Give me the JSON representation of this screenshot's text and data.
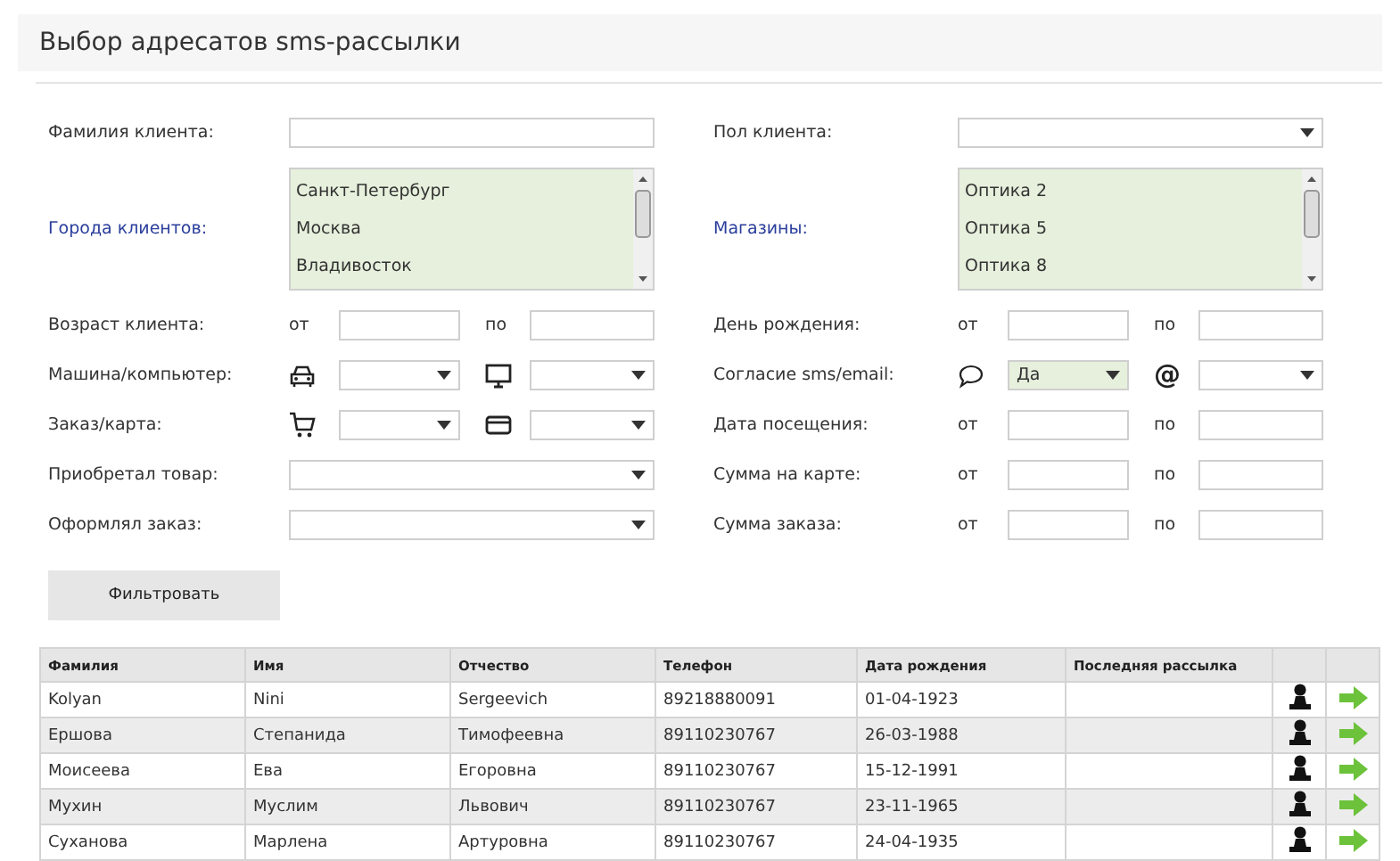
{
  "title": "Выбор адресатов sms-рассылки",
  "form": [
    {
      "left": {
        "label": "Фамилия клиента:",
        "kind": "text"
      },
      "right": {
        "label": "Пол клиента:",
        "kind": "select"
      }
    },
    {
      "left": {
        "label": "Города клиентов:",
        "kind": "listbox",
        "options": [
          "Санкт-Петербург",
          "Москва",
          "Владивосток"
        ]
      },
      "right": {
        "label": "Магазины:",
        "kind": "listbox",
        "options": [
          "Оптика 2",
          "Оптика 5",
          "Оптика 8"
        ]
      }
    },
    {
      "left": {
        "label": "Возраст клиента:",
        "kind": "range",
        "from": "от",
        "to": "по"
      },
      "right": {
        "label": "День рождения:",
        "kind": "range",
        "from": "от",
        "to": "по"
      }
    },
    {
      "left": {
        "label": "Машина/компьютер:",
        "kind": "pair",
        "selects": [
          {
            "kind": "car"
          },
          {
            "kind": "monitor"
          }
        ]
      },
      "right": {
        "label": "Согласие sms/email:",
        "kind": "pair",
        "selects": [
          {
            "kind": "bubble",
            "value": "Да"
          },
          {
            "kind": "symbol",
            "symbol": "@"
          }
        ]
      }
    },
    {
      "left": {
        "label": "Заказ/карта:",
        "kind": "pair",
        "selects": [
          {
            "kind": "cart"
          },
          {
            "kind": "card"
          }
        ]
      },
      "right": {
        "label": "Дата посещения:",
        "kind": "range",
        "from": "от",
        "to": "по"
      }
    },
    {
      "left": {
        "label": "Приобретал товар:",
        "kind": "select"
      },
      "right": {
        "label": "Сумма на карте:",
        "kind": "range",
        "from": "от",
        "to": "по"
      }
    },
    {
      "left": {
        "label": "Оформлял заказ:",
        "kind": "select"
      },
      "right": {
        "label": "Сумма заказа:",
        "kind": "range",
        "from": "от",
        "to": "по"
      }
    }
  ],
  "filter_button": "Фильтровать",
  "table": {
    "columns": [
      "Фамилия",
      "Имя",
      "Отчество",
      "Телефон",
      "Дата рождения",
      "Последняя рассылка"
    ],
    "rows": [
      [
        "Kolyan",
        "Nini",
        "Sergeevich",
        "89218880091",
        "01-04-1923",
        ""
      ],
      [
        "Ершова",
        "Степанида",
        "Тимофеевна",
        "89110230767",
        "26-03-1988",
        ""
      ],
      [
        "Моисеева",
        "Ева",
        "Егоровна",
        "89110230767",
        "15-12-1991",
        ""
      ],
      [
        "Мухин",
        "Муслим",
        "Львович",
        "89110230767",
        "23-11-1965",
        ""
      ],
      [
        "Суханова",
        "Марлена",
        "Артуровна",
        "89110230767",
        "24-04-1935",
        ""
      ]
    ]
  }
}
